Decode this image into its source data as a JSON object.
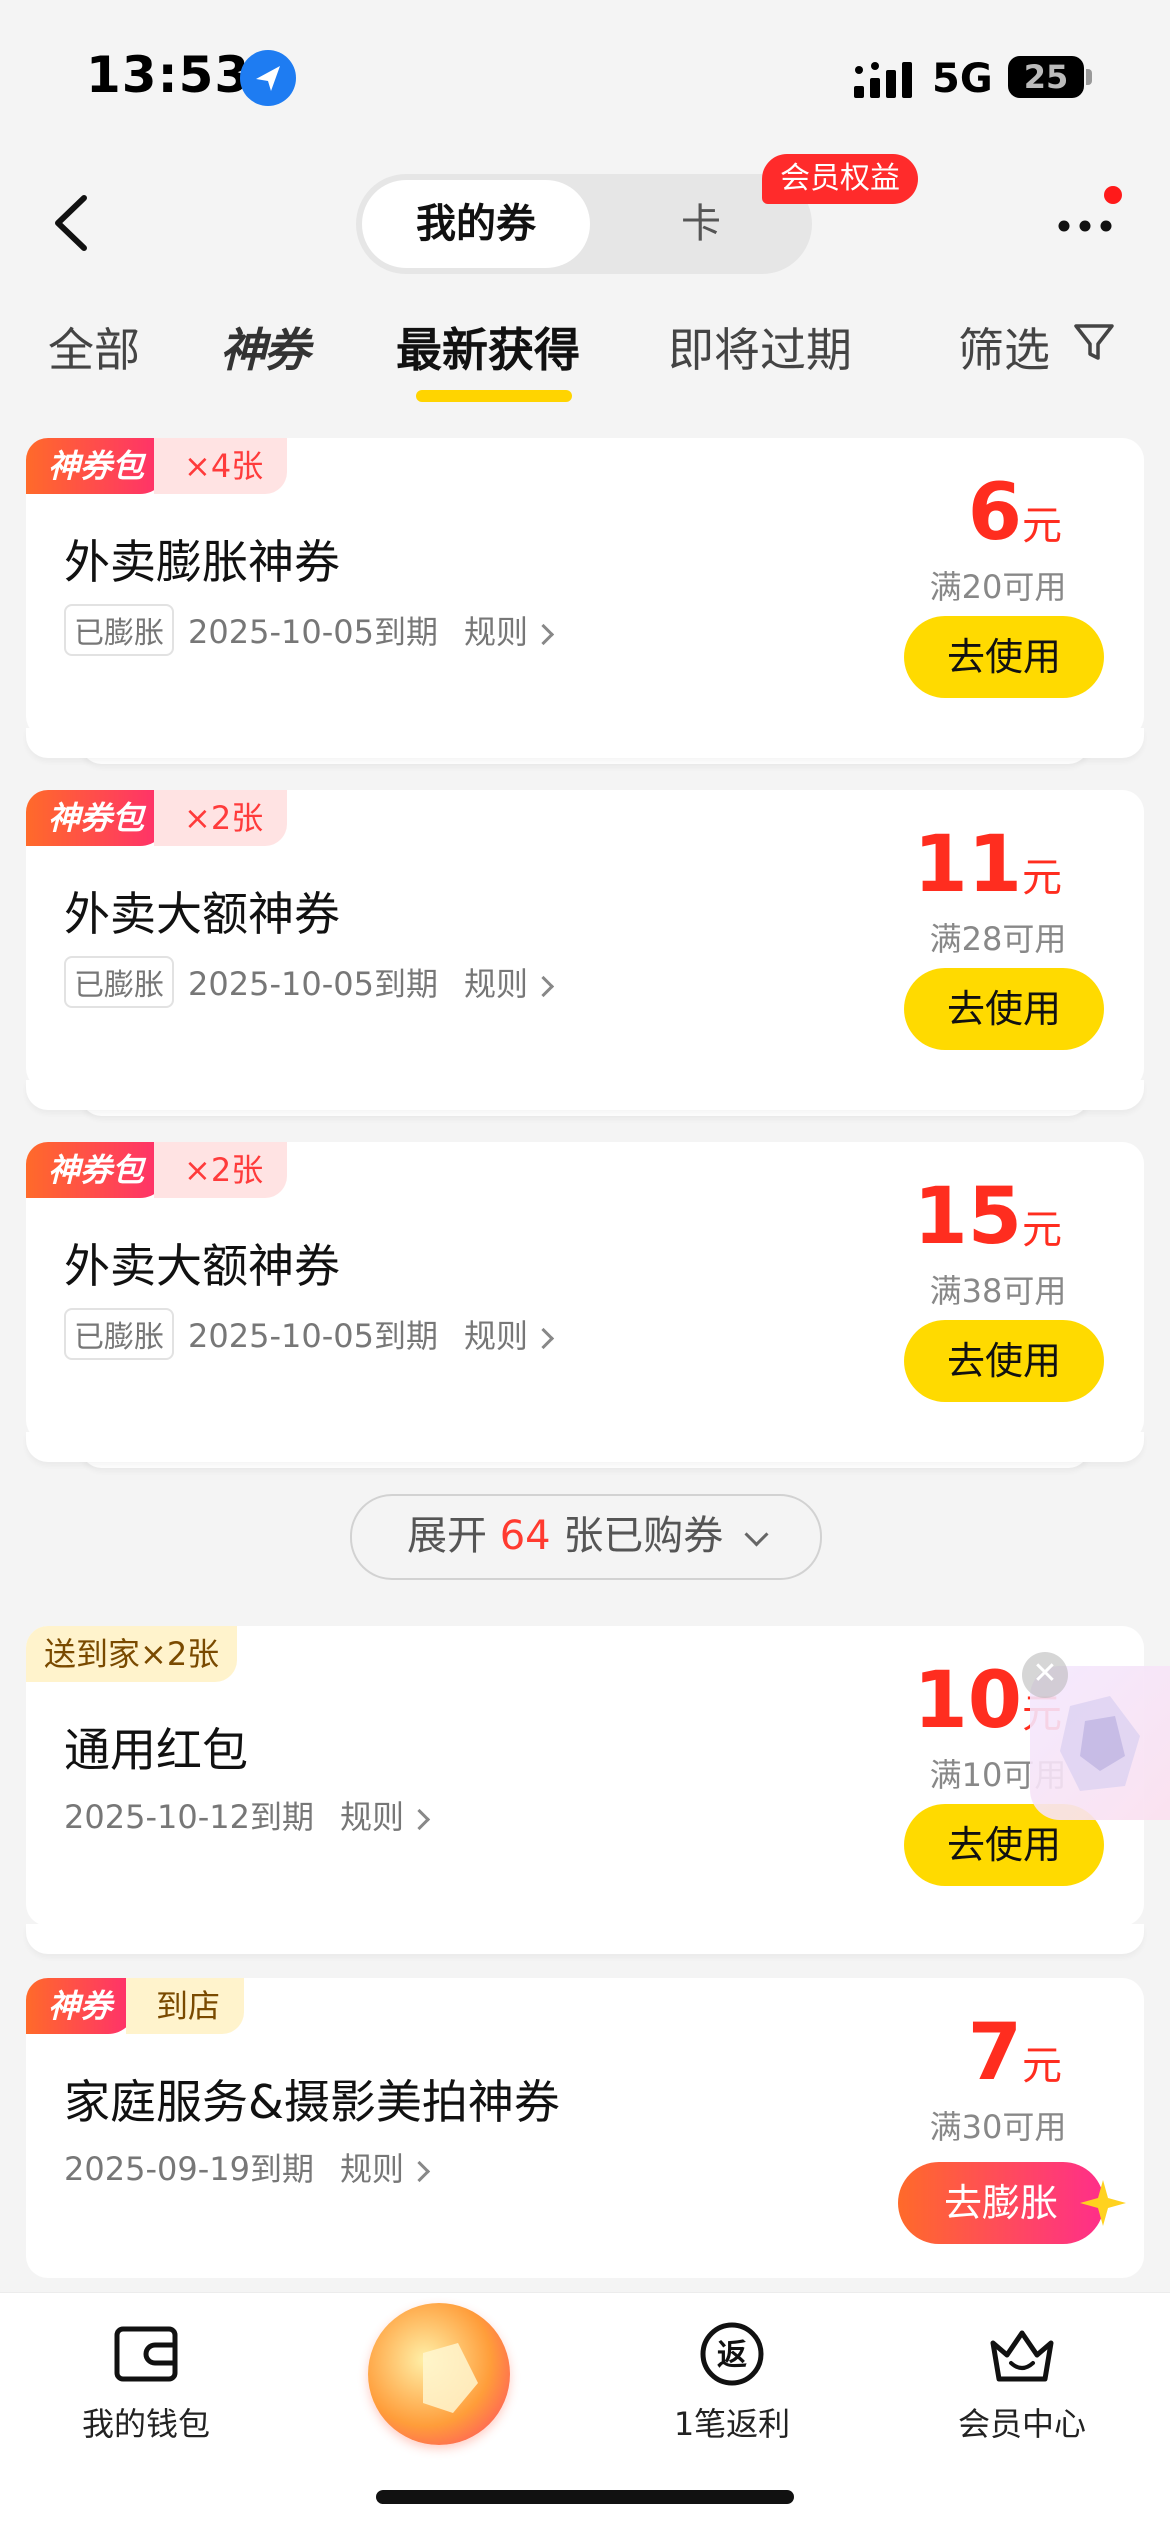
{
  "status": {
    "time": "13:53",
    "network": "5G",
    "battery": "25"
  },
  "header": {
    "segment_active": "我的券",
    "segment_other": "卡",
    "badge": "会员权益"
  },
  "tabs": [
    "全部",
    "神券",
    "最新获得",
    "即将过期",
    "筛选"
  ],
  "active_tab": "最新获得",
  "coupons": [
    {
      "tag": "神券包",
      "count": "×4张",
      "title": "外卖膨胀神券",
      "status": "已膨胀",
      "expiry": "2025-10-05到期",
      "rules": "规则",
      "amount": "6",
      "unit": "元",
      "threshold": "满20可用",
      "action": "去使用"
    },
    {
      "tag": "神券包",
      "count": "×2张",
      "title": "外卖大额神券",
      "status": "已膨胀",
      "expiry": "2025-10-05到期",
      "rules": "规则",
      "amount": "11",
      "unit": "元",
      "threshold": "满28可用",
      "action": "去使用"
    },
    {
      "tag": "神券包",
      "count": "×2张",
      "title": "外卖大额神券",
      "status": "已膨胀",
      "expiry": "2025-10-05到期",
      "rules": "规则",
      "amount": "15",
      "unit": "元",
      "threshold": "满38可用",
      "action": "去使用"
    },
    {
      "tag": "送到家×2张",
      "title": "通用红包",
      "expiry": "2025-10-12到期",
      "rules": "规则",
      "amount": "10",
      "unit": "元",
      "threshold": "满10可用",
      "action": "去使用"
    },
    {
      "tag": "神券",
      "tag2": "到店",
      "title": "家庭服务&摄影美拍神券",
      "expiry": "2025-09-19到期",
      "rules": "规则",
      "amount": "7",
      "unit": "元",
      "threshold": "满30可用",
      "action": "去膨胀"
    }
  ],
  "expand": {
    "prefix": "展开",
    "count": "64",
    "suffix": "张已购券"
  },
  "bottom_nav": [
    {
      "label": "我的钱包",
      "icon": "wallet-icon"
    },
    {
      "label": "1笔返利",
      "icon": "rebate-icon"
    },
    {
      "label": "会员中心",
      "icon": "crown-icon"
    }
  ],
  "colors": {
    "accent_yellow": "#ffda00",
    "price_red": "#ff2d1f",
    "brand_gradient_start": "#ff6a2a",
    "brand_gradient_end": "#ff2e6e"
  }
}
